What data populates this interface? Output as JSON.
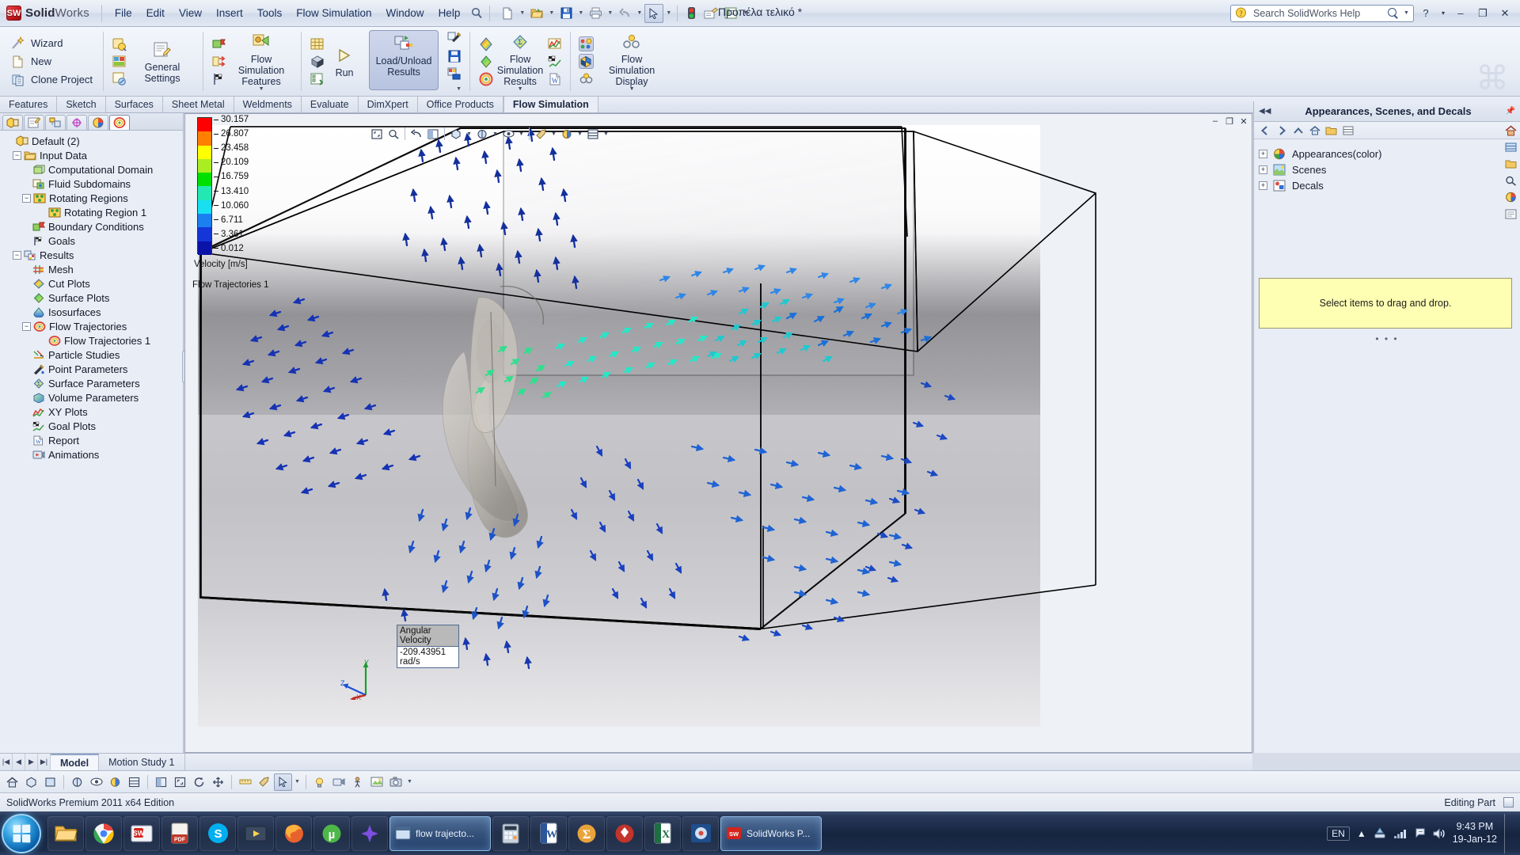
{
  "app": {
    "brand_bold": "Solid",
    "brand_light": "Works",
    "document_title": "Προπέλα τελικό *",
    "menus": [
      "File",
      "Edit",
      "View",
      "Insert",
      "Tools",
      "Flow Simulation",
      "Window",
      "Help"
    ],
    "window_buttons": [
      "?",
      "▾",
      "–",
      "❐",
      "✕"
    ]
  },
  "search": {
    "placeholder": "Search SolidWorks Help",
    "value": "Search SolidWorks Help",
    "icon": "search-icon"
  },
  "quick_toolbar": [
    {
      "name": "new-document-icon",
      "glyph": "🗋",
      "caret": true
    },
    {
      "name": "open-document-icon",
      "glyph": "📂",
      "caret": true
    },
    {
      "name": "save-icon",
      "glyph": "💾",
      "caret": true
    },
    {
      "name": "print-icon",
      "glyph": "🖨",
      "caret": true
    },
    {
      "name": "undo-icon",
      "glyph": "↶",
      "caret": true
    },
    {
      "name": "select-cursor-icon",
      "glyph": "↖",
      "caret": true,
      "framed": true
    },
    {
      "name": "rebuild-traffic-light-icon",
      "glyph": "🚦",
      "caret": false
    },
    {
      "name": "edit-appearance-icon",
      "glyph": "🎨",
      "caret": false
    },
    {
      "name": "options-icon",
      "glyph": "📋",
      "caret": true
    }
  ],
  "ribbon": {
    "group_project": [
      {
        "label": "Wizard",
        "icon": "wizard-wand-icon"
      },
      {
        "label": "New",
        "icon": "new-project-icon"
      },
      {
        "label": "Clone Project",
        "icon": "clone-project-icon"
      }
    ],
    "general_settings": {
      "label": "General Settings",
      "icons": [
        "general-settings-icon",
        "units-icon",
        "calculation-control-icon"
      ]
    },
    "flow_features": {
      "label": "Flow Simulation Features",
      "icons": [
        "boundary-condition-icon",
        "fan-icon",
        "goals-icon"
      ]
    },
    "run_group": {
      "label": "Run",
      "icons": [
        "mesh-icon",
        "batch-run-icon",
        "solver-icon"
      ]
    },
    "load_unload": {
      "label": "Load/Unload Results",
      "icons": [
        "load-unload-icon"
      ],
      "active": true
    },
    "results_tools": {
      "icons": [
        "probe-icon",
        "save-results-icon",
        "export-results-icon"
      ]
    },
    "flow_results": {
      "label": "Flow Simulation Results",
      "icons": [
        "cut-plot-icon",
        "surface-plot-icon",
        "flow-trajectories-icon"
      ]
    },
    "results_extra": {
      "icons": [
        "xy-plot-icon",
        "goal-plot-icon",
        "report-icon"
      ]
    },
    "flow_display": {
      "label": "Flow Simulation Display",
      "icons": [
        "display-colors-icon",
        "display-geometry-icon",
        "display-toggle-icon"
      ],
      "active": true
    }
  },
  "command_tabs": [
    {
      "label": "Features",
      "active": false
    },
    {
      "label": "Sketch",
      "active": false
    },
    {
      "label": "Surfaces",
      "active": false
    },
    {
      "label": "Sheet Metal",
      "active": false
    },
    {
      "label": "Weldments",
      "active": false
    },
    {
      "label": "Evaluate",
      "active": false
    },
    {
      "label": "DimXpert",
      "active": false
    },
    {
      "label": "Office Products",
      "active": false
    },
    {
      "label": "Flow Simulation",
      "active": true
    }
  ],
  "feature_tree": {
    "tabs": [
      {
        "name": "feature-manager-tab",
        "glyph": "🗂",
        "active": false
      },
      {
        "name": "property-manager-tab",
        "glyph": "🗒",
        "active": false
      },
      {
        "name": "configuration-manager-tab",
        "glyph": "🗃",
        "active": false
      },
      {
        "name": "dimxpert-manager-tab",
        "glyph": "✛",
        "active": false
      },
      {
        "name": "display-manager-tab",
        "glyph": "◕",
        "active": false
      },
      {
        "name": "flow-simulation-tree-tab",
        "glyph": "◎",
        "active": true
      }
    ],
    "nodes": [
      {
        "label": "Default (2)",
        "depth": 0,
        "toggle": "none",
        "icon": "project-icon"
      },
      {
        "label": "Input Data",
        "depth": 1,
        "toggle": "minus",
        "icon": "input-data-folder-icon"
      },
      {
        "label": "Computational Domain",
        "depth": 2,
        "toggle": "none",
        "icon": "computational-domain-icon"
      },
      {
        "label": "Fluid Subdomains",
        "depth": 2,
        "toggle": "none",
        "icon": "fluid-subdomains-icon"
      },
      {
        "label": "Rotating Regions",
        "depth": 2,
        "toggle": "minus",
        "icon": "rotating-regions-icon"
      },
      {
        "label": "Rotating Region 1",
        "depth": 3,
        "toggle": "none",
        "icon": "rotating-region-icon"
      },
      {
        "label": "Boundary Conditions",
        "depth": 2,
        "toggle": "none",
        "icon": "boundary-conditions-icon"
      },
      {
        "label": "Goals",
        "depth": 2,
        "toggle": "none",
        "icon": "goals-flag-icon"
      },
      {
        "label": "Results",
        "depth": 1,
        "toggle": "minus",
        "icon": "results-icon"
      },
      {
        "label": "Mesh",
        "depth": 2,
        "toggle": "none",
        "icon": "mesh-grid-icon"
      },
      {
        "label": "Cut Plots",
        "depth": 2,
        "toggle": "none",
        "icon": "cut-plot-icon"
      },
      {
        "label": "Surface Plots",
        "depth": 2,
        "toggle": "none",
        "icon": "surface-plot-icon"
      },
      {
        "label": "Isosurfaces",
        "depth": 2,
        "toggle": "none",
        "icon": "isosurface-icon"
      },
      {
        "label": "Flow Trajectories",
        "depth": 2,
        "toggle": "minus",
        "icon": "flow-trajectories-icon"
      },
      {
        "label": "Flow Trajectories 1",
        "depth": 3,
        "toggle": "none",
        "icon": "flow-trajectories-icon"
      },
      {
        "label": "Particle Studies",
        "depth": 2,
        "toggle": "none",
        "icon": "particle-studies-icon"
      },
      {
        "label": "Point Parameters",
        "depth": 2,
        "toggle": "none",
        "icon": "point-parameters-icon"
      },
      {
        "label": "Surface Parameters",
        "depth": 2,
        "toggle": "none",
        "icon": "surface-parameters-icon"
      },
      {
        "label": "Volume Parameters",
        "depth": 2,
        "toggle": "none",
        "icon": "volume-parameters-icon"
      },
      {
        "label": "XY Plots",
        "depth": 2,
        "toggle": "none",
        "icon": "xy-plot-icon"
      },
      {
        "label": "Goal Plots",
        "depth": 2,
        "toggle": "none",
        "icon": "goal-plot-icon"
      },
      {
        "label": "Report",
        "depth": 2,
        "toggle": "none",
        "icon": "report-icon"
      },
      {
        "label": "Animations",
        "depth": 2,
        "toggle": "none",
        "icon": "animations-icon"
      }
    ]
  },
  "viewport": {
    "window_buttons": [
      "–",
      "❐",
      "✕"
    ],
    "view_toolbar": [
      {
        "name": "zoom-to-fit-icon",
        "glyph": "⛶"
      },
      {
        "name": "zoom-area-icon",
        "glyph": "🔍"
      },
      {
        "name": "previous-view-icon",
        "glyph": "↩"
      },
      {
        "name": "section-view-icon",
        "glyph": "◧"
      },
      {
        "name": "view-orientation-icon",
        "glyph": "⬚",
        "caret": true
      },
      {
        "name": "display-style-icon",
        "glyph": "◍",
        "caret": true
      },
      {
        "name": "hide-show-icon",
        "glyph": "👁",
        "caret": true
      },
      {
        "name": "edit-appearance-icon",
        "glyph": "🎨",
        "caret": true
      },
      {
        "name": "apply-scene-icon",
        "glyph": "◑",
        "caret": true
      },
      {
        "name": "view-settings-icon",
        "glyph": "▦",
        "caret": true
      }
    ],
    "legend": {
      "title": "Velocity [m/s]",
      "plot_name": "Flow Trajectories 1",
      "ticks": [
        "30.157",
        "26.807",
        "23.458",
        "20.109",
        "16.759",
        "13.410",
        "10.060",
        "6.711",
        "3.361",
        "0.012"
      ],
      "colors": [
        "#ff0000",
        "#ff8000",
        "#ffff00",
        "#aaee22",
        "#00e000",
        "#24e8b4",
        "#18e0f0",
        "#1b7ff0",
        "#1436d8",
        "#0a12a8"
      ]
    },
    "annotation": {
      "label": "Angular Velocity",
      "value": "-209.43951 rad/s"
    },
    "triad": {
      "x": "X",
      "y": "Y",
      "z": "Z"
    }
  },
  "model_tabs": [
    {
      "label": "Model",
      "active": true
    },
    {
      "label": "Motion Study 1",
      "active": false
    }
  ],
  "bottom_toolbar": [
    {
      "name": "home-icon",
      "glyph": "⌂"
    },
    {
      "name": "view-orientation-icon",
      "glyph": "⬚"
    },
    {
      "name": "front-view-icon",
      "glyph": "▣"
    },
    {
      "name": "display-style-icon",
      "glyph": "◍"
    },
    {
      "name": "hide-show-icon",
      "glyph": "👁"
    },
    {
      "name": "apply-scene-icon",
      "glyph": "◑"
    },
    {
      "name": "view-settings-icon",
      "glyph": "▦"
    },
    {
      "name": "section-view-icon",
      "glyph": "◧"
    },
    {
      "name": "zoom-to-fit-icon",
      "glyph": "⛶"
    },
    {
      "name": "rotate-view-icon",
      "glyph": "⟳"
    },
    {
      "name": "pan-icon",
      "glyph": "✥"
    },
    {
      "name": "select-cursor-icon",
      "glyph": "↖"
    },
    {
      "name": "measure-icon",
      "glyph": "📏"
    },
    {
      "name": "appearance-icon",
      "glyph": "🎨"
    },
    {
      "name": "lights-icon",
      "glyph": "💡"
    },
    {
      "name": "camera-icon",
      "glyph": "🎥"
    },
    {
      "name": "walkthrough-icon",
      "glyph": "🚶"
    },
    {
      "name": "render-icon",
      "glyph": "🖼"
    },
    {
      "name": "screen-capture-icon",
      "glyph": "📷"
    }
  ],
  "status_bar": {
    "left_text": "SolidWorks Premium 2011 x64 Edition",
    "right_text": "Editing Part"
  },
  "right_panel": {
    "title": "Appearances, Scenes, and Decals",
    "pin_icon": "pin-icon",
    "collapse_icon": "chevron-left-icon",
    "toolbar": [
      {
        "name": "back-icon",
        "glyph": "◀"
      },
      {
        "name": "forward-icon",
        "glyph": "▶"
      },
      {
        "name": "up-folder-icon",
        "glyph": "▲"
      },
      {
        "name": "home-folder-icon",
        "glyph": "🏠"
      },
      {
        "name": "new-folder-icon",
        "glyph": "📁"
      },
      {
        "name": "view-options-icon",
        "glyph": "▤"
      }
    ],
    "tree": [
      {
        "label": "Appearances(color)",
        "icon": "appearances-icon"
      },
      {
        "label": "Scenes",
        "icon": "scenes-icon"
      },
      {
        "label": "Decals",
        "icon": "decals-icon"
      }
    ],
    "dropzone_text": "Select items to drag and drop.",
    "vtools": [
      {
        "name": "home-view-icon",
        "glyph": "🏠"
      },
      {
        "name": "design-library-icon",
        "glyph": "🗄"
      },
      {
        "name": "file-explorer-icon",
        "glyph": "📁"
      },
      {
        "name": "search-panel-icon",
        "glyph": "🔍"
      },
      {
        "name": "appearances-panel-icon",
        "glyph": "🎨"
      },
      {
        "name": "custom-properties-icon",
        "glyph": "📑"
      }
    ]
  },
  "taskbar": {
    "start_label": "start-orb",
    "items": [
      {
        "name": "taskbar-explorer",
        "glyph": "📁",
        "active": false
      },
      {
        "name": "taskbar-chrome",
        "glyph": "◉",
        "active": false
      },
      {
        "name": "taskbar-solidworks-launcher",
        "glyph": "SW",
        "active": false
      },
      {
        "name": "taskbar-pdf",
        "glyph": "📕",
        "active": false
      },
      {
        "name": "taskbar-skype",
        "glyph": "S",
        "active": false
      },
      {
        "name": "taskbar-media",
        "glyph": "🎬",
        "active": false
      },
      {
        "name": "taskbar-firefox-alt",
        "glyph": "🔥",
        "active": false
      },
      {
        "name": "taskbar-utorrent",
        "glyph": "µ",
        "active": false
      },
      {
        "name": "taskbar-editor",
        "glyph": "✦",
        "active": false
      }
    ],
    "windows": [
      {
        "name": "taskbar-window-flow-trajectories",
        "label": "flow trajecto...",
        "glyph": "🗔",
        "active": true
      }
    ],
    "items2": [
      {
        "name": "taskbar-calculator",
        "glyph": "▦",
        "active": false
      },
      {
        "name": "taskbar-word",
        "glyph": "W",
        "active": false
      },
      {
        "name": "taskbar-sigma",
        "glyph": "Σ",
        "active": false
      },
      {
        "name": "taskbar-pokerstars",
        "glyph": "♠",
        "active": false
      },
      {
        "name": "taskbar-excel",
        "glyph": "X",
        "active": false
      },
      {
        "name": "taskbar-cad",
        "glyph": "◔",
        "active": false
      }
    ],
    "windows2": [
      {
        "name": "taskbar-window-solidworks",
        "label": "SolidWorks P...",
        "glyph": "SW",
        "active": true
      }
    ],
    "tray": {
      "language": "EN",
      "expand_icon": "chevron-up-icon",
      "icons": [
        {
          "name": "tray-safely-remove-icon",
          "glyph": "⏏"
        },
        {
          "name": "tray-network-icon",
          "glyph": "📶"
        },
        {
          "name": "tray-action-center-icon",
          "glyph": "🏳"
        },
        {
          "name": "tray-volume-icon",
          "glyph": "🔊"
        }
      ],
      "time": "9:43 PM",
      "date": "19-Jan-12"
    }
  }
}
